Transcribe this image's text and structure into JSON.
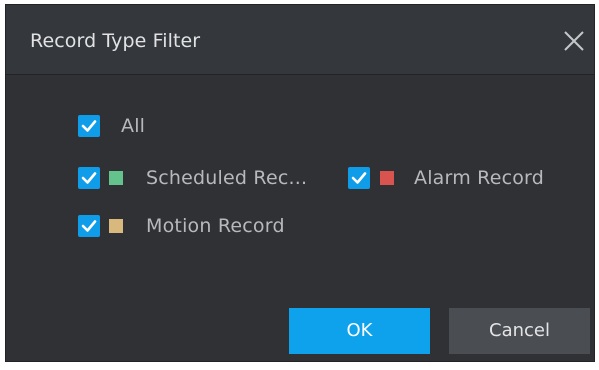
{
  "dialog": {
    "title": "Record Type Filter",
    "close_icon": "close-icon"
  },
  "filters": {
    "all": {
      "label": "All",
      "checked": true
    },
    "items": [
      {
        "label": "Scheduled Rec...",
        "checked": true,
        "color": "#64c28d"
      },
      {
        "label": "Alarm Record",
        "checked": true,
        "color": "#d9534f"
      },
      {
        "label": "Motion Record",
        "checked": true,
        "color": "#d8b87c"
      }
    ]
  },
  "buttons": {
    "ok_label": "OK",
    "cancel_label": "Cancel"
  },
  "colors": {
    "accent": "#0ea1ec",
    "dialog_bg": "#2f3135",
    "title_bg": "#34373b"
  }
}
